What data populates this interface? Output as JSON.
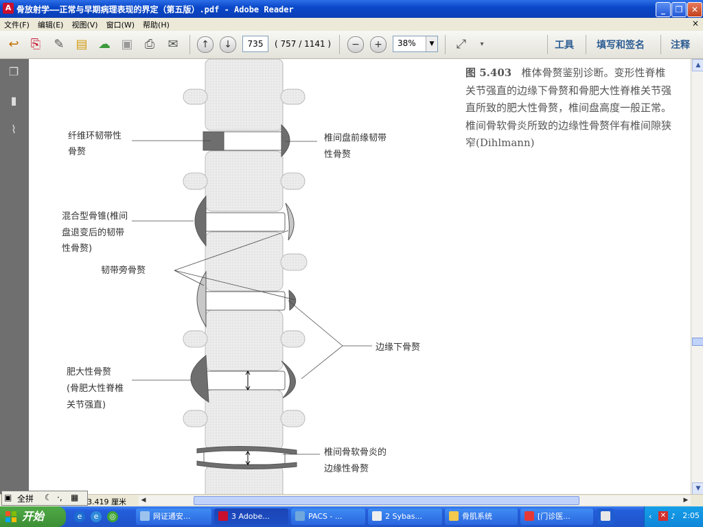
{
  "window": {
    "title": "骨放射学——正常与早期病理表现的界定（第五版）.pdf - Adobe Reader",
    "app_icon": "pdf-icon"
  },
  "window_controls": {
    "minimize": "_",
    "restore": "❐",
    "close": "✕"
  },
  "menu": {
    "items": [
      "文件(F)",
      "编辑(E)",
      "视图(V)",
      "窗口(W)",
      "帮助(H)"
    ],
    "close_glyph": "×"
  },
  "toolbar": {
    "page_current": "735",
    "page_count": "( 757 / 1141 )",
    "zoom": "38%",
    "links": {
      "tools": "工具",
      "fill_sign": "填写和签名",
      "comment": "注释"
    }
  },
  "document": {
    "caption": {
      "figure": "图 5.403",
      "text": "椎体骨赘鉴别诊断。变形性脊椎关节强直的边缘下骨赘和骨肥大性脊椎关节强直所致的肥大性骨赘，椎间盘高度一般正常。椎间骨软骨炎所致的边缘性骨赘伴有椎间隙狭窄(Dihlmann)"
    },
    "labels": {
      "fibrous_1": "纤维环韧带性",
      "fibrous_2": "骨赘",
      "anterior_1": "椎间盘前缘韧带",
      "anterior_2": "性骨赘",
      "mixed_1": "混合型骨锥(椎间",
      "mixed_2": "盘退变后的韧带",
      "mixed_3": "性骨赘)",
      "paraligament": "韧带旁骨赘",
      "submarginal": "边缘下骨赘",
      "hyper_1": "肥大性骨赘",
      "hyper_2": "(骨肥大性脊椎",
      "hyper_3": "关节强直)",
      "osteochondrosis_1": "椎间骨软骨炎的",
      "osteochondrosis_2": "边缘性骨赘"
    }
  },
  "statusbar": {
    "ime_mode": "全拼",
    "dimensions": "3.419 厘米"
  },
  "taskbar": {
    "start": "开始",
    "tasks": [
      "网证通安...",
      "3 Adobe...",
      "PACS - ...",
      "2 Sybas...",
      "骨肌系统",
      "[门诊医..."
    ],
    "clock": "2:05"
  },
  "colors": {
    "titlebar": "#0a48c9",
    "taskbar": "#245edb",
    "start": "#3c8f34",
    "sidepanel": "#6f6f6f"
  }
}
